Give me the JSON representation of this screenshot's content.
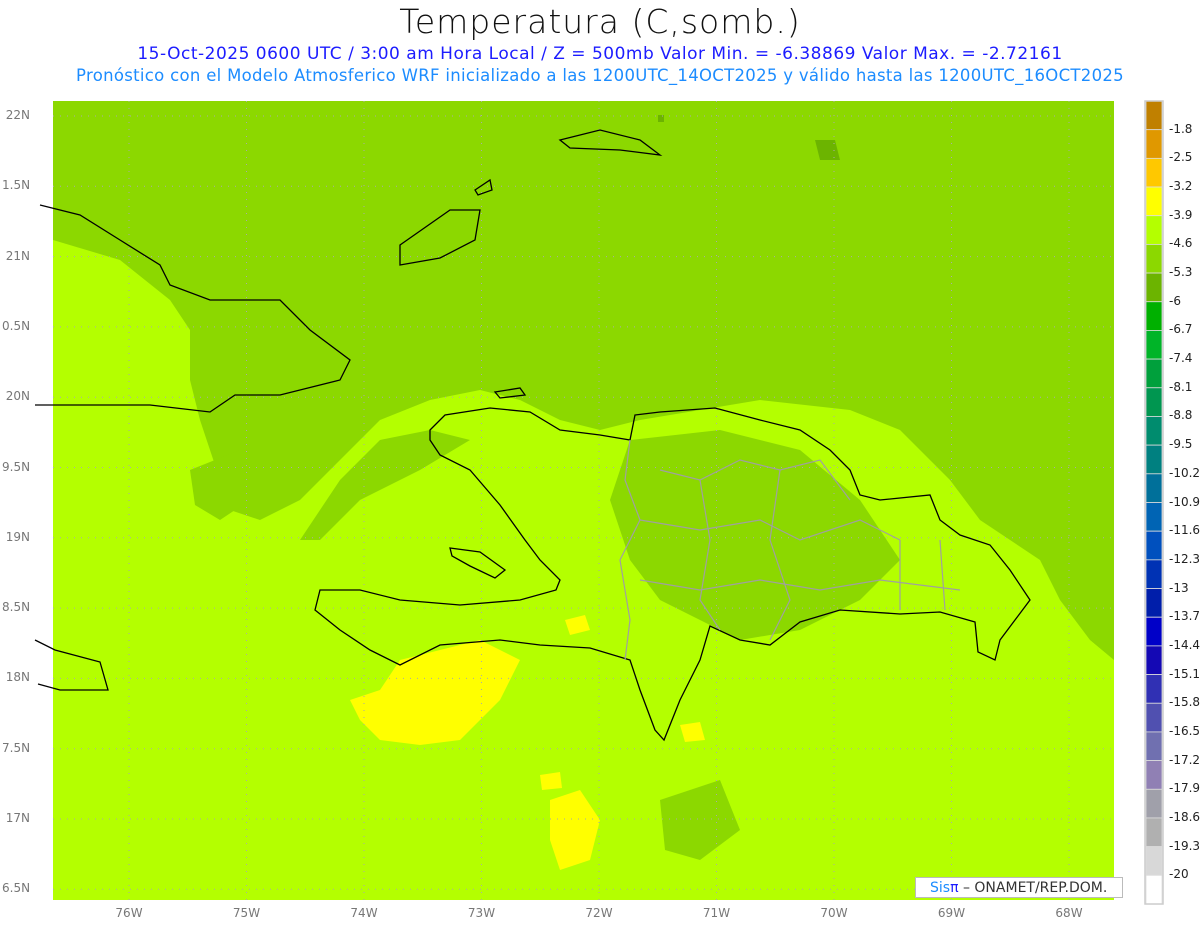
{
  "header": {
    "title": "Temperatura (C,somb.)",
    "line1": "15-Oct-2025  0600 UTC / 3:00 am Hora Local / Z = 500mb  Valor Min. = -6.38869  Valor Max. = -2.72161",
    "line2": "Pronóstico con el Modelo Atmosferico WRF inicializado a las 1200UTC_14OCT2025 y válido hasta las  1200UTC_16OCT2025"
  },
  "axes": {
    "lat_labels": [
      "22N",
      "1.5N",
      "21N",
      "0.5N",
      "20N",
      "9.5N",
      "19N",
      "8.5N",
      "18N",
      "7.5N",
      "17N",
      "6.5N"
    ],
    "lon_labels": [
      "76W",
      "75W",
      "74W",
      "73W",
      "72W",
      "71W",
      "70W",
      "69W",
      "68W"
    ]
  },
  "colorbar": {
    "labels": [
      "-1.8",
      "-2.5",
      "-3.2",
      "-3.9",
      "-4.6",
      "-5.3",
      "-6",
      "-6.7",
      "-7.4",
      "-8.1",
      "-8.8",
      "-9.5",
      "-10.2",
      "-10.9",
      "-11.6",
      "-12.3",
      "-13",
      "-13.7",
      "-14.4",
      "-15.1",
      "-15.8",
      "-16.5",
      "-17.2",
      "-17.9",
      "-18.6",
      "-19.3",
      "-20"
    ],
    "colors": [
      "#c08000",
      "#e09800",
      "#ffc800",
      "#ffff00",
      "#b4ff00",
      "#8cd800",
      "#6cb400",
      "#00b000",
      "#00b428",
      "#00a03c",
      "#009650",
      "#008c6e",
      "#008080",
      "#00709a",
      "#0064b4",
      "#0050be",
      "#0032b4",
      "#001eaa",
      "#0000c8",
      "#1408b4",
      "#3030b4",
      "#5050b0",
      "#7070b0",
      "#9080b4",
      "#a0a0aa",
      "#b0b0b0",
      "#d8d8d8",
      "#ffffff"
    ]
  },
  "map_colors": {
    "light": "#b4ff00",
    "mid": "#8cd800",
    "dark": "#6cb400",
    "yellow": "#ffff00",
    "coast": "#000000",
    "provinces": "#a0a0a0"
  },
  "logo": {
    "sis": "Sis",
    "pi": "π",
    "rest": " –  ONAMET/REP.DOM."
  }
}
